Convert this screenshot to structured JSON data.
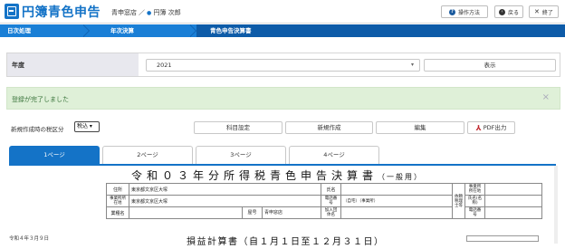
{
  "header": {
    "app_title": "円簿青色申告",
    "store": "青申窓店",
    "separator": "／",
    "user": "円簿 次郎",
    "buttons": {
      "help": "操作方法",
      "back": "戻る",
      "exit": "終了"
    }
  },
  "breadcrumb": [
    "日次処理",
    "年次決算",
    "青色申告決算書"
  ],
  "year": {
    "label": "年度",
    "selected": "2021",
    "show_button": "表示"
  },
  "alert": {
    "message": "登録が完了しました",
    "close": "×"
  },
  "actions": {
    "tax_label": "新規作成時の税区分",
    "tax_value": "税込",
    "account_settings": "科目設定",
    "new": "新規作成",
    "edit": "編集",
    "pdf": "PDF出力"
  },
  "tabs": [
    "1ページ",
    "2ページ",
    "3ページ",
    "4ページ"
  ],
  "document": {
    "title": "令和０３年分所得税青色申告決算書",
    "subtitle": "（一般用）",
    "address_label": "住所",
    "address_value": "東京都文京区大塚",
    "name_label": "氏名",
    "office_address_label": "事業所所在地",
    "office_address_value": "東京都文京区大塚",
    "phone_label": "電話番号",
    "phone_note": "（自宅）（事業所）",
    "business_type_label": "業種名",
    "shop_label": "屋号",
    "shop_value": "青申窓店",
    "member_label": "加入団体名",
    "requester_label": "依頼税理士等",
    "req_office_label": "事業所所在地",
    "req_name_label": "氏名(名称)",
    "req_phone_label": "電話番号",
    "date": "令和４年３月９日",
    "pl_title": "損益計算書（自１月１日至１２月３１日）"
  },
  "colors": {
    "brand": "#1473c7",
    "crumb_bg": "#1a7fd6",
    "crumb_active": "#0d5ba8",
    "alert_bg": "#dff0d8",
    "alert_text": "#3c763d"
  }
}
